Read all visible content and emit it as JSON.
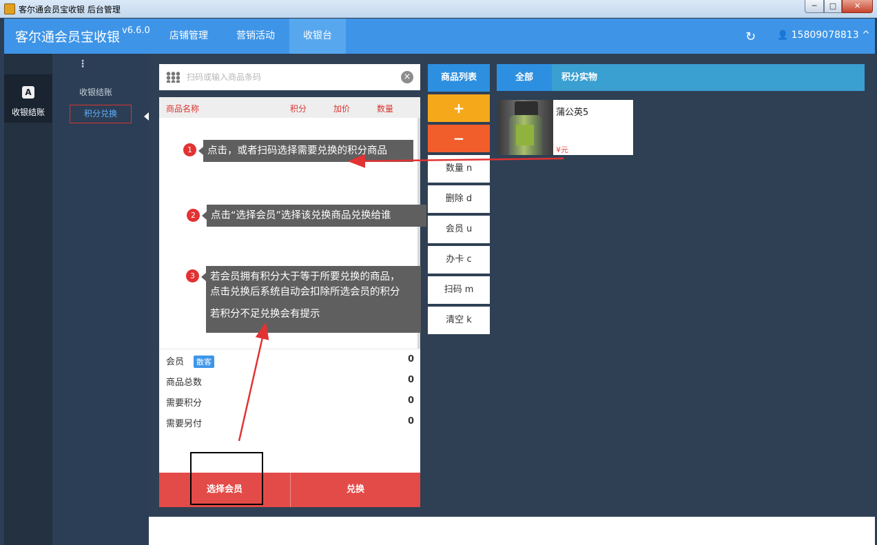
{
  "window": {
    "title": "客尔通会员宝收银 后台管理",
    "min": "─",
    "max": "□",
    "close": "✕"
  },
  "topnav": {
    "brand": "客尔通会员宝收银",
    "version": "v6.6.0",
    "items": [
      "店铺管理",
      "营销活动",
      "收银台"
    ],
    "active_item": "收银台",
    "refresh_icon": "↻",
    "user": "15809078813",
    "user_icon": "👤",
    "chevron": "^"
  },
  "leftbar": {
    "dots": "⋮",
    "active_badge": "A",
    "active_label": "收银结账"
  },
  "subnav": {
    "items": [
      "收银结账",
      "积分兑换"
    ],
    "active": "积分兑换"
  },
  "search": {
    "placeholder": "扫码或输入商品条码",
    "value": "",
    "clear_icon": "×"
  },
  "cart": {
    "headers": [
      "商品名称",
      "积分",
      "加价",
      "数量"
    ]
  },
  "summary": {
    "member_label": "会员",
    "member_tag": "散客",
    "member_value": "0",
    "total_items_label": "商品总数",
    "total_items_value": "0",
    "points_label": "需要积分",
    "points_value": "0",
    "extra_pay_label": "需要另付",
    "extra_pay_value": "0"
  },
  "buttons": {
    "select_member": "选择会员",
    "exchange": "兑换"
  },
  "actions": {
    "product_list": "商品列表",
    "plus": "+",
    "minus": "−",
    "quantity": "数量 n",
    "delete": "删除 d",
    "member": "会员 u",
    "card": "办卡 c",
    "scan": "扫码 m",
    "clear": "清空 k"
  },
  "category_tabs": [
    "全部",
    "积分实物"
  ],
  "products": [
    {
      "name": "蒲公英5",
      "price": "¥元"
    }
  ],
  "annotations": {
    "step1": {
      "num": "1",
      "text": "点击，或者扫码选择需要兑换的积分商品"
    },
    "step2": {
      "num": "2",
      "text": "点击“选择会员”选择该兑换商品兑换给谁"
    },
    "step3": {
      "num": "3",
      "line1": "若会员拥有积分大于等于所要兑换的商品，",
      "line2": "点击兑换后系统自动会扣除所选会员的积分",
      "line3": "若积分不足兑换会有提示"
    }
  },
  "colors": {
    "nav_blue": "#3e95e8",
    "accent_red": "#e34b48",
    "orange": "#f6a81b",
    "orange_red": "#f25d2c",
    "sidebar_dark": "#233140"
  }
}
